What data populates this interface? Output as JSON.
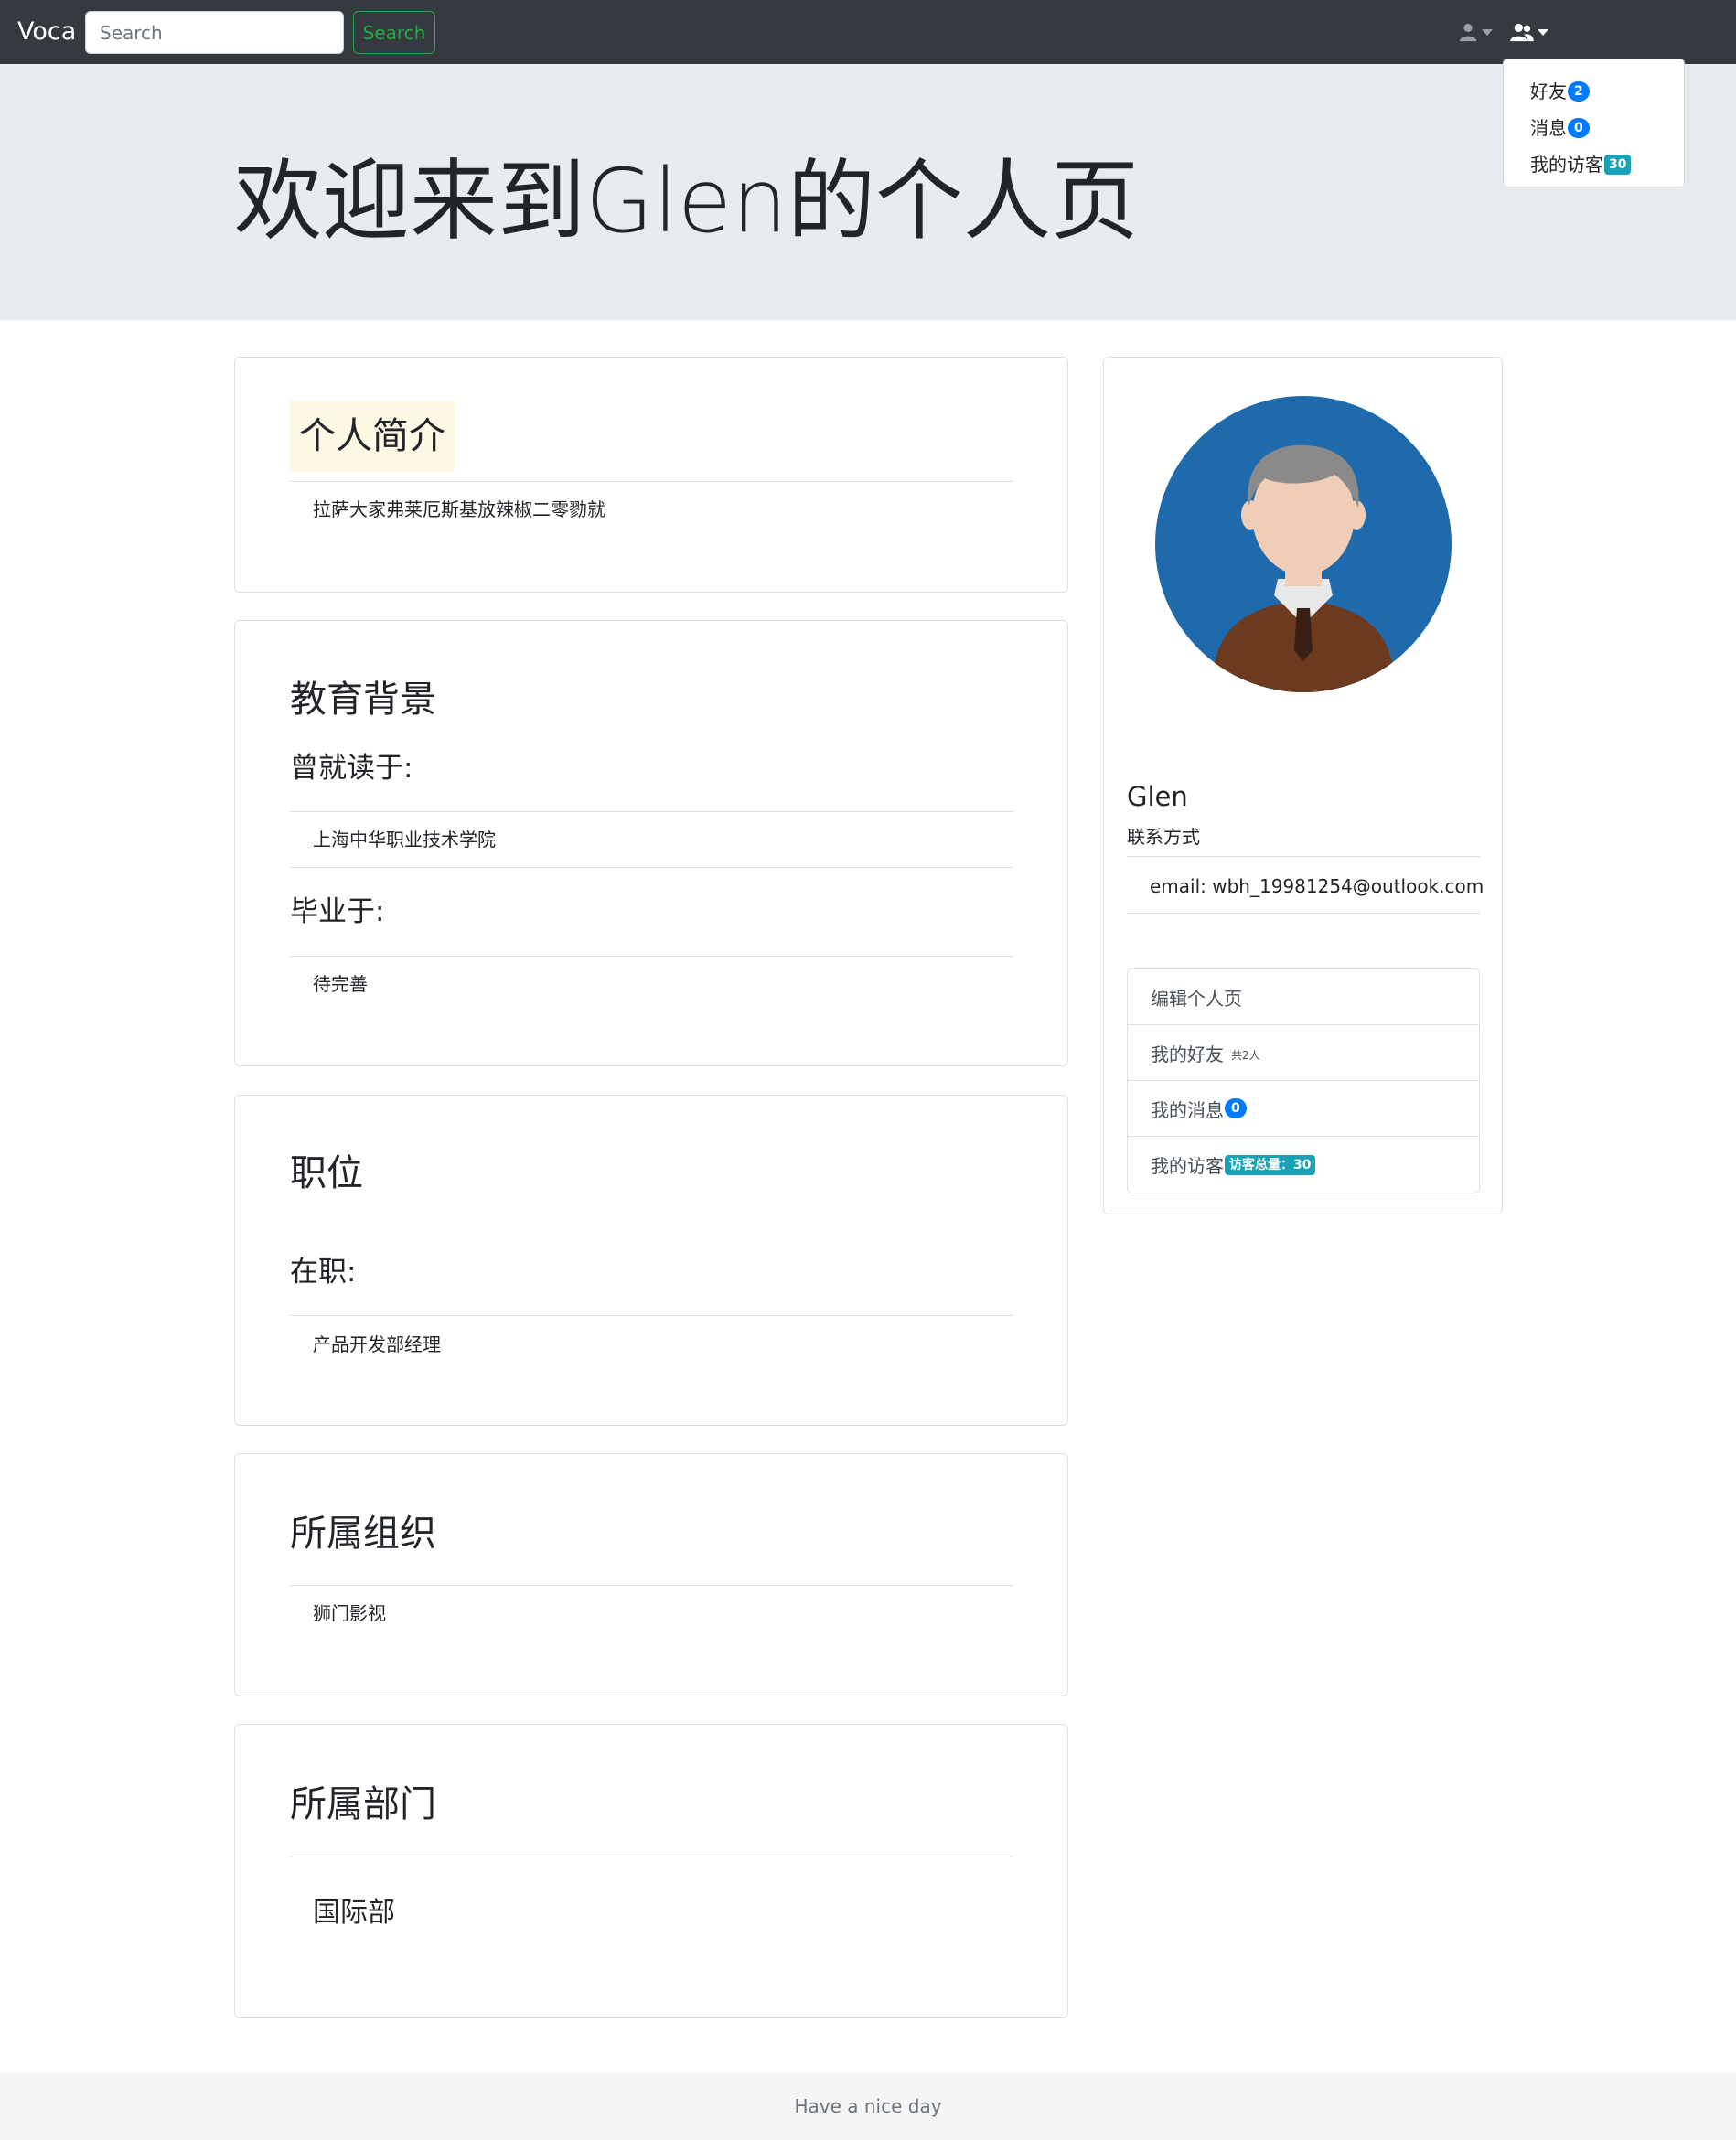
{
  "navbar": {
    "brand": "Voca",
    "search_placeholder": "Search",
    "search_button": "Search"
  },
  "dropdown": {
    "items": [
      {
        "label": "好友",
        "badge": "2"
      },
      {
        "label": "消息",
        "badge": "0"
      },
      {
        "label": "我的访客",
        "badge": "30"
      }
    ]
  },
  "jumbotron": {
    "title": "欢迎来到Glen的个人页"
  },
  "intro": {
    "title": "个人简介",
    "text": "拉萨大家弗莱厄斯基放辣椒二零勠就"
  },
  "education": {
    "title": "教育背景",
    "studied_label": "曾就读于:",
    "studied_value": "上海中华职业技术学院",
    "graduated_label": "毕业于:",
    "graduated_value": "待完善"
  },
  "position": {
    "title": "职位",
    "current_label": "在职:",
    "current_value": "产品开发部经理"
  },
  "organization": {
    "title": "所属组织",
    "value": "狮门影视"
  },
  "department": {
    "title": "所属部门",
    "value": "国际部"
  },
  "profile": {
    "name": "Glen",
    "contact_label": "联系方式",
    "email": "email: wbh_19981254@outlook.com",
    "links": {
      "edit": "编辑个人页",
      "friends": "我的好友",
      "friends_note": "共2人",
      "messages": "我的消息",
      "messages_badge": "0",
      "visitors": "我的访客",
      "visitors_badge": "访客总量：30"
    }
  },
  "footer": {
    "text": "Have a nice day"
  },
  "colors": {
    "navbar": "#343a40",
    "jumbotron": "#e9ecef",
    "success": "#28a745",
    "primary": "#007bff",
    "info": "#17a2b8",
    "avatar_bg": "#1f6aad"
  },
  "icons": {
    "user_menu": "user-icon",
    "friends_menu": "users-icon"
  }
}
